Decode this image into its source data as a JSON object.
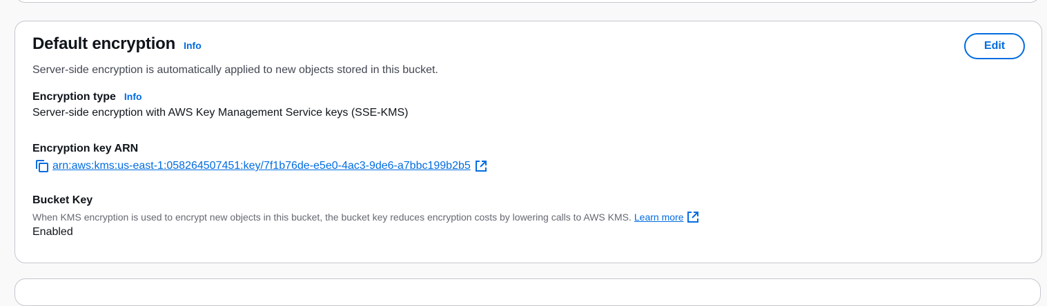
{
  "panel": {
    "title": "Default encryption",
    "info_label": "Info",
    "description": "Server-side encryption is automatically applied to new objects stored in this bucket.",
    "edit_label": "Edit"
  },
  "encryption_type": {
    "label": "Encryption type",
    "info_label": "Info",
    "value": "Server-side encryption with AWS Key Management Service keys (SSE-KMS)"
  },
  "encryption_key_arn": {
    "label": "Encryption key ARN",
    "value": "arn:aws:kms:us-east-1:058264507451:key/7f1b76de-e5e0-4ac3-9de6-a7bbc199b2b5",
    "copy_icon": "copy-icon",
    "external_icon": "external-link-icon"
  },
  "bucket_key": {
    "label": "Bucket Key",
    "description": "When KMS encryption is used to encrypt new objects in this bucket, the bucket key reduces encryption costs by lowering calls to AWS KMS.",
    "learn_more_label": "Learn more",
    "value": "Enabled",
    "external_icon": "external-link-icon"
  },
  "colors": {
    "link": "#006ce0",
    "border": "#c6c6cd",
    "text": "#0f141a",
    "secondary_text": "#656871"
  }
}
